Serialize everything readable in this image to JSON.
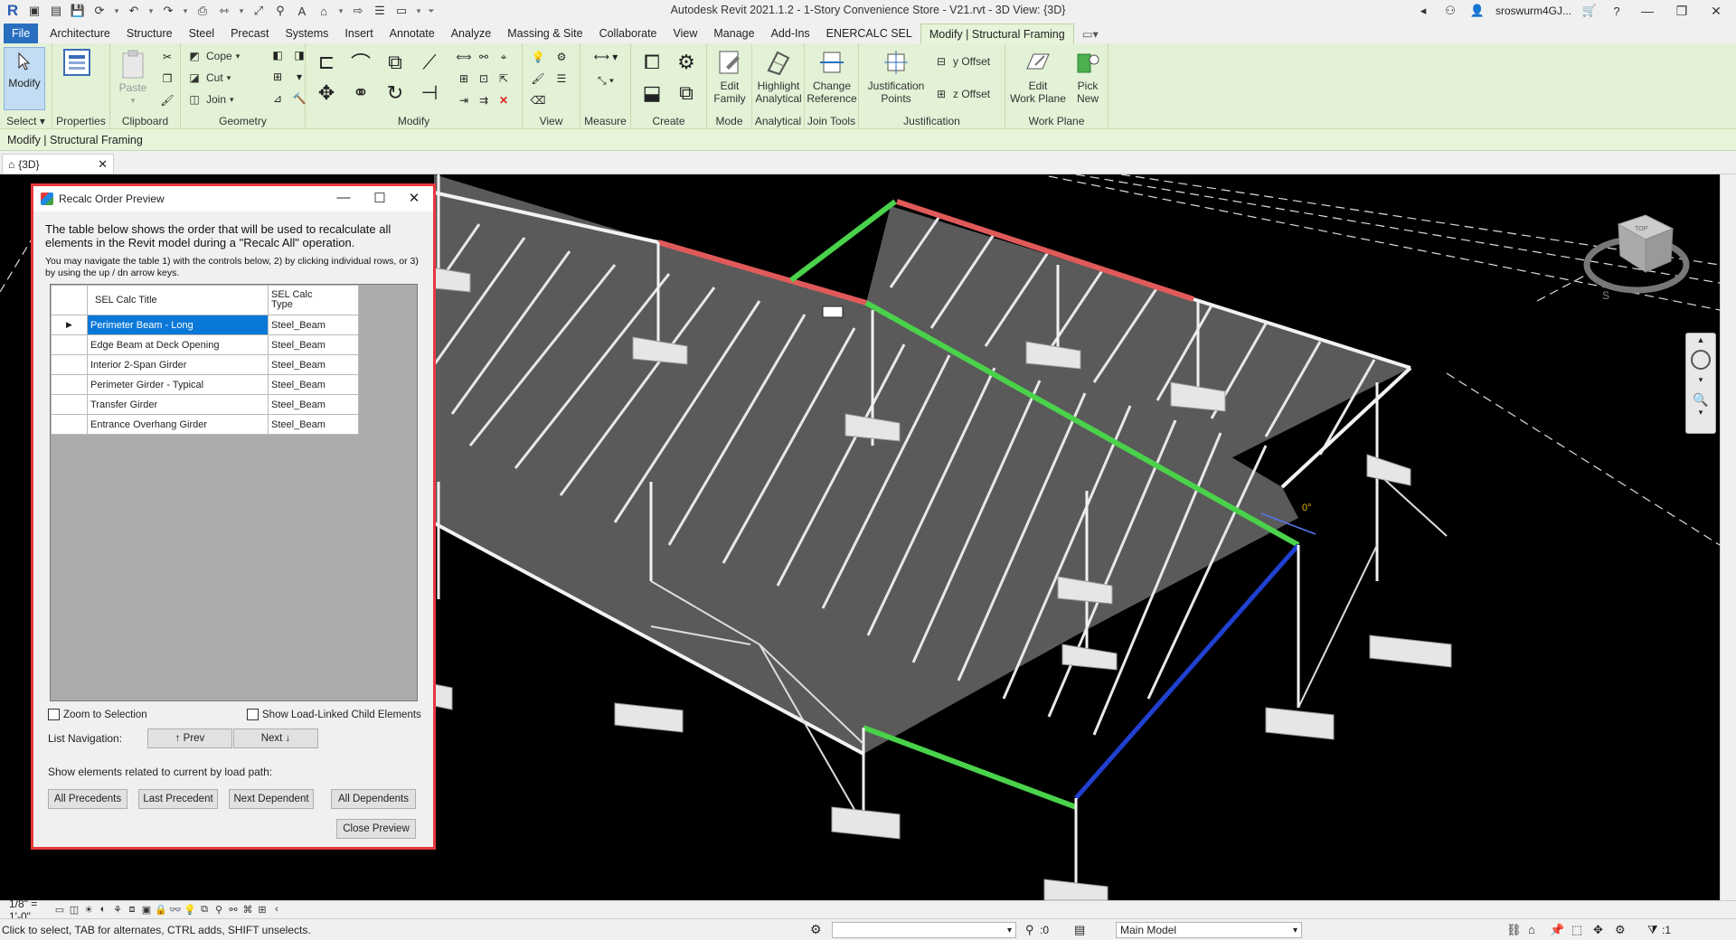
{
  "app": {
    "title": "Autodesk Revit 2021.1.2 - 1-Story Convenience Store - V21.rvt - 3D View: {3D}",
    "user": "sroswurm4GJ...",
    "logo": "R"
  },
  "tabs": [
    "File",
    "Architecture",
    "Structure",
    "Steel",
    "Precast",
    "Systems",
    "Insert",
    "Annotate",
    "Analyze",
    "Massing & Site",
    "Collaborate",
    "View",
    "Manage",
    "Add-Ins",
    "ENERCALC SEL",
    "Modify | Structural Framing"
  ],
  "ribbon": {
    "modify_label": "Modify",
    "select_label": "Select ▾",
    "properties_label": "Properties",
    "paste_label": "Paste",
    "clipboard_label": "Clipboard",
    "cope_label": "Cope",
    "cut_label": "Cut",
    "join_label": "Join",
    "geometry_label": "Geometry",
    "modify_panel_label": "Modify",
    "view_label": "View",
    "measure_label": "Measure",
    "create_label": "Create",
    "edit_family_1": "Edit",
    "edit_family_2": "Family",
    "mode_label": "Mode",
    "highlight_1": "Highlight",
    "highlight_2": "Analytical",
    "analytical_label": "Analytical",
    "change_ref_1": "Change",
    "change_ref_2": "Reference",
    "join_tools_label": "Join Tools",
    "just_points_1": "Justification",
    "just_points_2": "Points",
    "y_offset": "y Offset",
    "z_offset": "z Offset",
    "justification_label": "Justification",
    "edit_wp_1": "Edit",
    "edit_wp_2": "Work Plane",
    "pick_new_1": "Pick",
    "pick_new_2": "New",
    "work_plane_label": "Work Plane"
  },
  "context_bar": "Modify | Structural Framing",
  "view_tab": "{3D}",
  "dialog": {
    "title": "Recalc Order Preview",
    "desc1": "The table below shows the order that will be used to recalculate all elements in the Revit model during a \"Recalc All\" operation.",
    "desc2": "You may navigate the table 1) with the controls below, 2) by clicking individual rows, or 3) by using the up / dn arrow keys.",
    "col_title": "SEL Calc Title",
    "col_type_1": "SEL Calc",
    "col_type_2": "Type",
    "rows": [
      {
        "title": "Perimeter Beam - Long",
        "type": "Steel_Beam"
      },
      {
        "title": "Edge Beam at Deck Opening",
        "type": "Steel_Beam"
      },
      {
        "title": "Interior 2-Span Girder",
        "type": "Steel_Beam"
      },
      {
        "title": "Perimeter Girder - Typical",
        "type": "Steel_Beam"
      },
      {
        "title": "Transfer Girder",
        "type": "Steel_Beam"
      },
      {
        "title": "Entrance Overhang Girder",
        "type": "Steel_Beam"
      }
    ],
    "zoom_to_selection": "Zoom to Selection",
    "show_load_linked": "Show Load-Linked Child Elements",
    "list_navigation": "List Navigation:",
    "prev": "↑ Prev",
    "next": "Next ↓",
    "related_label": "Show elements related to current by load path:",
    "all_precedents": "All Precedents",
    "last_precedent": "Last Precedent",
    "next_dependent": "Next Dependent",
    "all_dependents": "All Dependents",
    "close_preview": "Close Preview"
  },
  "viewport": {
    "angle_label": "0°",
    "cube_top": "TOP",
    "compass_s": "S",
    "colors": {
      "red": "#e05a5a",
      "green": "#4ad24a",
      "blue": "#2040d0",
      "deck": "#5a5a5a",
      "steel": "#f2f2f2"
    }
  },
  "view_control": {
    "scale": "1/8\" = 1'-0\""
  },
  "status": {
    "message": "Click to select, TAB for alternates, CTRL adds, SHIFT unselects.",
    "filter_count": ":0",
    "model": "Main Model",
    "select_count": ":1"
  }
}
